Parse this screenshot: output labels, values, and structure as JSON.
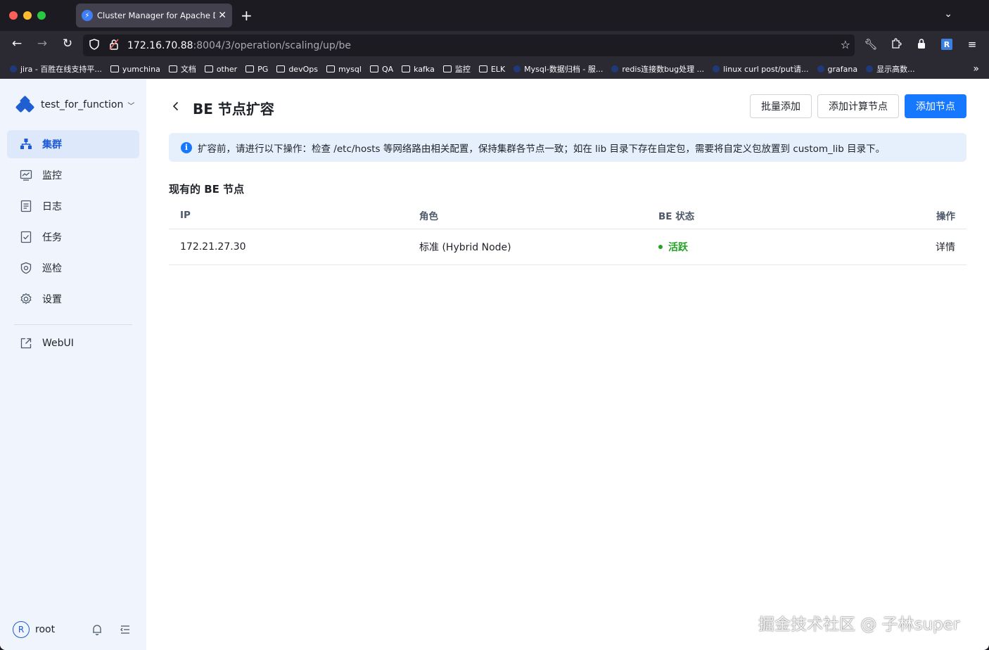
{
  "browser": {
    "tab_title": "Cluster Manager for Apache Doris",
    "url_host": "172.16.70.88",
    "url_path": ":8004/3/operation/scaling/up/be",
    "bookmarks": [
      {
        "label": "jira - 百胜在线支持平...",
        "kind": "site"
      },
      {
        "label": "yumchina",
        "kind": "folder"
      },
      {
        "label": "文档",
        "kind": "folder"
      },
      {
        "label": "other",
        "kind": "folder"
      },
      {
        "label": "PG",
        "kind": "folder"
      },
      {
        "label": "devOps",
        "kind": "folder"
      },
      {
        "label": "mysql",
        "kind": "folder"
      },
      {
        "label": "QA",
        "kind": "folder"
      },
      {
        "label": "kafka",
        "kind": "folder"
      },
      {
        "label": "监控",
        "kind": "folder"
      },
      {
        "label": "ELK",
        "kind": "folder"
      },
      {
        "label": "Mysql-数据归档 - 服...",
        "kind": "site"
      },
      {
        "label": "redis连接数bug处理 ...",
        "kind": "site"
      },
      {
        "label": "linux curl post/put请...",
        "kind": "site"
      },
      {
        "label": "grafana",
        "kind": "site"
      },
      {
        "label": "显示高数...",
        "kind": "site"
      }
    ]
  },
  "sidebar": {
    "cluster_name": "test_for_function",
    "items": [
      {
        "label": "集群",
        "icon": "cluster-icon",
        "active": true
      },
      {
        "label": "监控",
        "icon": "monitor-icon",
        "active": false
      },
      {
        "label": "日志",
        "icon": "log-icon",
        "active": false
      },
      {
        "label": "任务",
        "icon": "task-icon",
        "active": false
      },
      {
        "label": "巡检",
        "icon": "inspect-icon",
        "active": false
      },
      {
        "label": "设置",
        "icon": "gear-icon",
        "active": false
      }
    ],
    "webui_label": "WebUI",
    "user": {
      "avatar_letter": "R",
      "name": "root"
    }
  },
  "page": {
    "title": "BE 节点扩容",
    "buttons": {
      "batch_add": "批量添加",
      "add_compute": "添加计算节点",
      "add_node": "添加节点"
    },
    "notice": "扩容前，请进行以下操作：检查 /etc/hosts 等网络路由相关配置，保持集群各节点一致；如在 lib 目录下存在自定包，需要将自定义包放置到 custom_lib 目录下。",
    "section_title": "现有的 BE 节点",
    "table": {
      "columns": [
        "IP",
        "角色",
        "BE 状态",
        "操作"
      ],
      "rows": [
        {
          "ip": "172.21.27.30",
          "role": "标准 (Hybrid Node)",
          "status": "活跃",
          "action": "详情"
        }
      ]
    }
  },
  "colors": {
    "primary": "#1677ff",
    "status_active": "#23a323",
    "sidebar_bg": "#eff4fd"
  },
  "watermark": "掘金技术社区 @ 子林super"
}
